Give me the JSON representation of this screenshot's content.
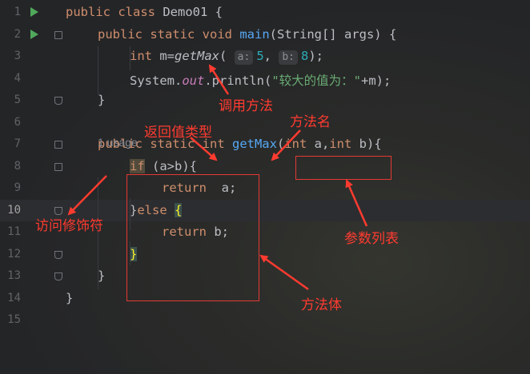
{
  "editor": {
    "usage_hint": "1 usage",
    "lines": [
      {
        "num": "1",
        "parts": [
          [
            "kw",
            "public "
          ],
          [
            "kw",
            "class "
          ],
          [
            "",
            "Demo01 {"
          ]
        ]
      },
      {
        "num": "2",
        "parts": [
          [
            "kw",
            "public "
          ],
          [
            "kw",
            "static "
          ],
          [
            "kw",
            "void "
          ],
          [
            "fn",
            "main"
          ],
          [
            "",
            "(String[] args) {"
          ]
        ]
      },
      {
        "num": "3",
        "parts": [
          [
            "kw",
            "int "
          ],
          [
            "",
            "m="
          ],
          [
            "italic",
            "getMax"
          ],
          [
            "",
            "( "
          ],
          [
            "hint",
            "a:"
          ],
          [
            "num",
            "5"
          ],
          [
            "",
            ", "
          ],
          [
            "hint",
            "b:"
          ],
          [
            "num",
            "8"
          ],
          [
            "",
            ");"
          ]
        ]
      },
      {
        "num": "4",
        "parts": [
          [
            "",
            "System."
          ],
          [
            "stat",
            "out"
          ],
          [
            "",
            ".println("
          ],
          [
            "str",
            "\"较大的值为：\""
          ],
          [
            "",
            "+m);"
          ]
        ]
      },
      {
        "num": "5",
        "parts": [
          [
            "",
            "}"
          ]
        ]
      },
      {
        "num": "6",
        "parts": []
      },
      {
        "num": "7",
        "parts": [
          [
            "kw",
            "public "
          ],
          [
            "kw",
            "static "
          ],
          [
            "kw",
            "int "
          ],
          [
            "fn",
            "getMax"
          ],
          [
            "",
            "("
          ],
          [
            "kw",
            "int "
          ],
          [
            "",
            "a,"
          ],
          [
            "kw",
            "int "
          ],
          [
            "",
            "b){"
          ]
        ]
      },
      {
        "num": "8",
        "parts": [
          [
            "ifhl",
            "if"
          ],
          [
            "",
            " (a>b){"
          ]
        ]
      },
      {
        "num": "9",
        "parts": [
          [
            "kw",
            "return "
          ],
          [
            "",
            " a;"
          ]
        ]
      },
      {
        "num": "10",
        "parts": [
          [
            "",
            "}"
          ],
          [
            "kw",
            "else "
          ],
          [
            "bracehl",
            "{"
          ]
        ]
      },
      {
        "num": "11",
        "parts": [
          [
            "kw",
            "return "
          ],
          [
            "",
            "b;"
          ]
        ]
      },
      {
        "num": "12",
        "parts": [
          [
            "bracehl",
            "}"
          ]
        ]
      },
      {
        "num": "13",
        "parts": [
          [
            "",
            "}"
          ]
        ]
      },
      {
        "num": "14",
        "parts": [
          [
            "",
            "}"
          ]
        ]
      },
      {
        "num": "15",
        "parts": []
      }
    ],
    "active_line": "10"
  },
  "annotations": {
    "call_method": "调用方法",
    "return_type": "返回值类型",
    "method_name": "方法名",
    "access_modifier": "访问修饰符",
    "param_list": "参数列表",
    "method_body": "方法体"
  },
  "colors": {
    "annotation": "#ff3b30",
    "run_icon": "#4fa85b"
  },
  "icons": {
    "run": "run-gutter-icon",
    "fold": "fold-marker-icon"
  }
}
